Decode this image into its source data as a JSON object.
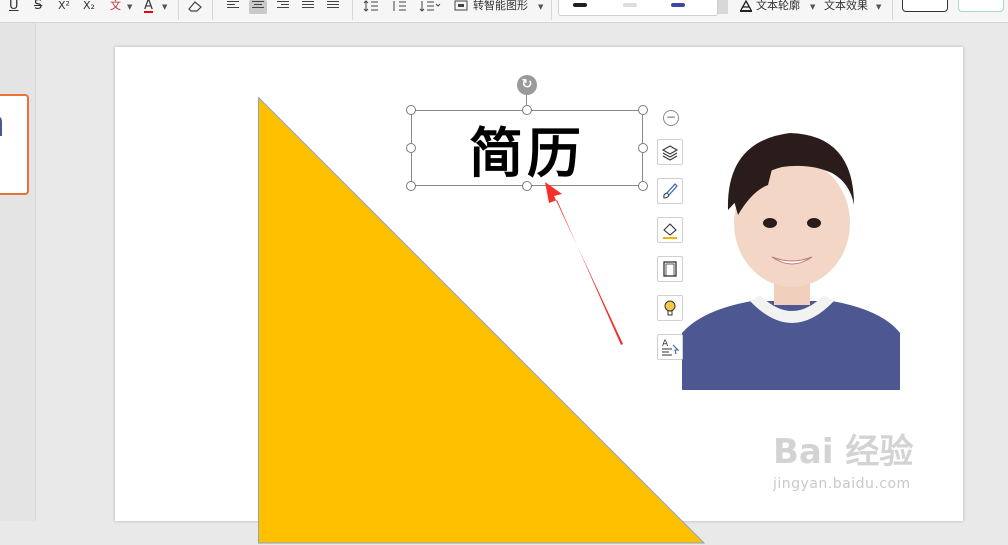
{
  "ribbon": {
    "underline_label": "U",
    "strike_label": "S",
    "superscript_label": "X²",
    "subscript_label": "X₂",
    "pinyin_label": "文",
    "font_color_label": "A",
    "smart_shape_label": "转智能图形",
    "text_outline_label": "文本轮廓",
    "text_effect_label": "文本效果"
  },
  "slide": {
    "textbox_text": "简历"
  },
  "watermark": {
    "logo_text": "Bai 经验",
    "url_text": "jingyan.baidu.com"
  },
  "colors": {
    "triangle_fill": "#FFC000",
    "arrow": "#F5302A",
    "thumb_selected_border": "#E8703A",
    "photo_sweater": "#4D5791"
  },
  "icons": {
    "collapse": "minus-circle-icon",
    "layers": "layers-icon",
    "brush": "brush-icon",
    "fill": "fill-bucket-icon",
    "frame": "frame-icon",
    "bulb": "bulb-icon",
    "text_wrap": "text-wrap-icon",
    "rotate": "rotate-icon"
  }
}
